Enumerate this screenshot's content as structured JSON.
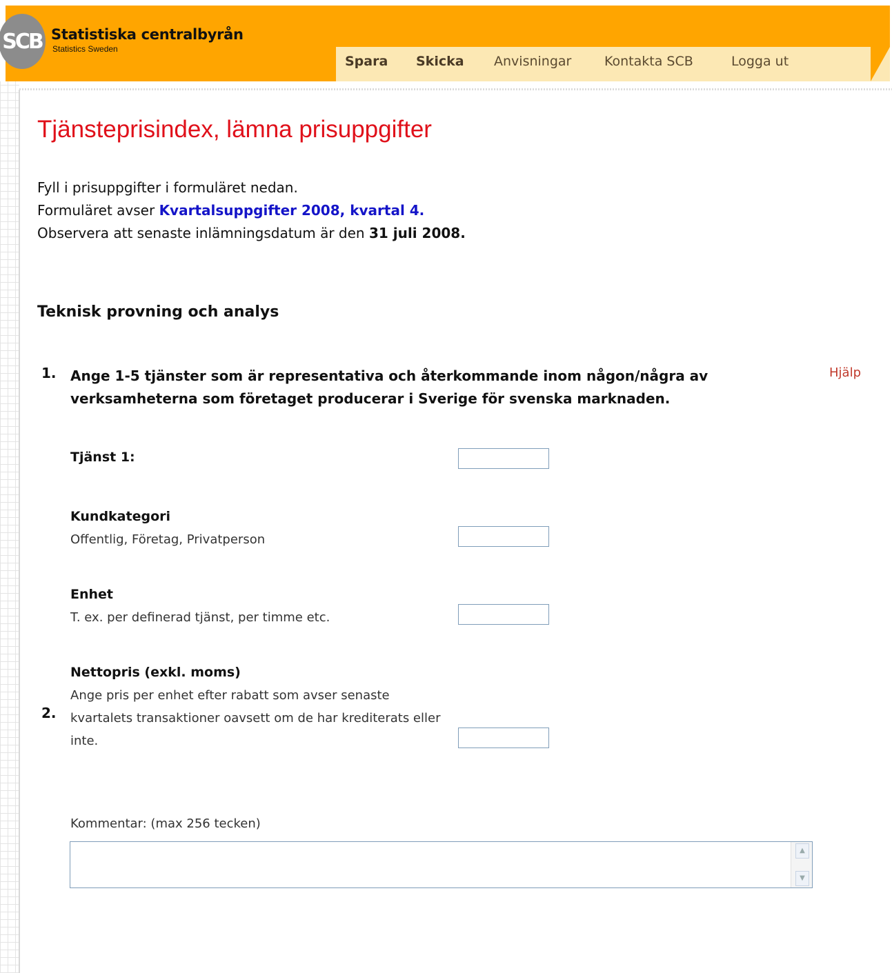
{
  "header": {
    "logo_text": "SCB",
    "brand_title": "Statistiska centralbyrån",
    "brand_subtitle": "Statistics Sweden",
    "nav": [
      {
        "label": "Spara",
        "bold": true
      },
      {
        "label": "Skicka",
        "bold": true
      },
      {
        "label": "Anvisningar",
        "bold": false
      },
      {
        "label": "Kontakta SCB",
        "bold": false
      },
      {
        "label": "Logga ut",
        "bold": false
      }
    ],
    "colors": {
      "bar": "#ffa500",
      "nav_bg": "#fce8b4",
      "title_red": "#e0101a",
      "highlight_blue": "#1414c8"
    }
  },
  "main": {
    "title": "Tjänsteprisindex, lämna prisuppgifter",
    "intro_line1": "Fyll i prisuppgifter i formuläret nedan.",
    "intro_line2_prefix": "Formuläret avser ",
    "intro_line2_highlight": "Kvartalsuppgifter 2008, kvartal 4.",
    "intro_line3_prefix": "Observera att senaste inlämningsdatum är den ",
    "intro_line3_date": "31 juli 2008",
    "intro_line3_suffix": ".",
    "section_heading": "Teknisk provning och analys",
    "question1": {
      "number": "1.",
      "text": "Ange 1-5 tjänster som är representativa och återkommande inom någon/några av verksamheterna som företaget producerar i Sverige för svenska marknaden.",
      "help": "Hjälp"
    },
    "fields": [
      {
        "label": "Tjänst 1:",
        "desc": "",
        "value": ""
      },
      {
        "label": "Kundkategori",
        "desc": "Offentlig, Företag, Privatperson",
        "value": ""
      },
      {
        "label": "Enhet",
        "desc": "T. ex. per definerad tjänst, per timme etc.",
        "value": ""
      },
      {
        "label": "Nettopris (exkl. moms)",
        "desc": "Ange pris per enhet efter rabatt som avser senaste kvartalets transaktioner oavsett om de har krediterats eller inte.",
        "value": ""
      }
    ],
    "comment_label": "Kommentar: (max 256 tecken)",
    "comment_value": "",
    "question2_number": "2."
  }
}
